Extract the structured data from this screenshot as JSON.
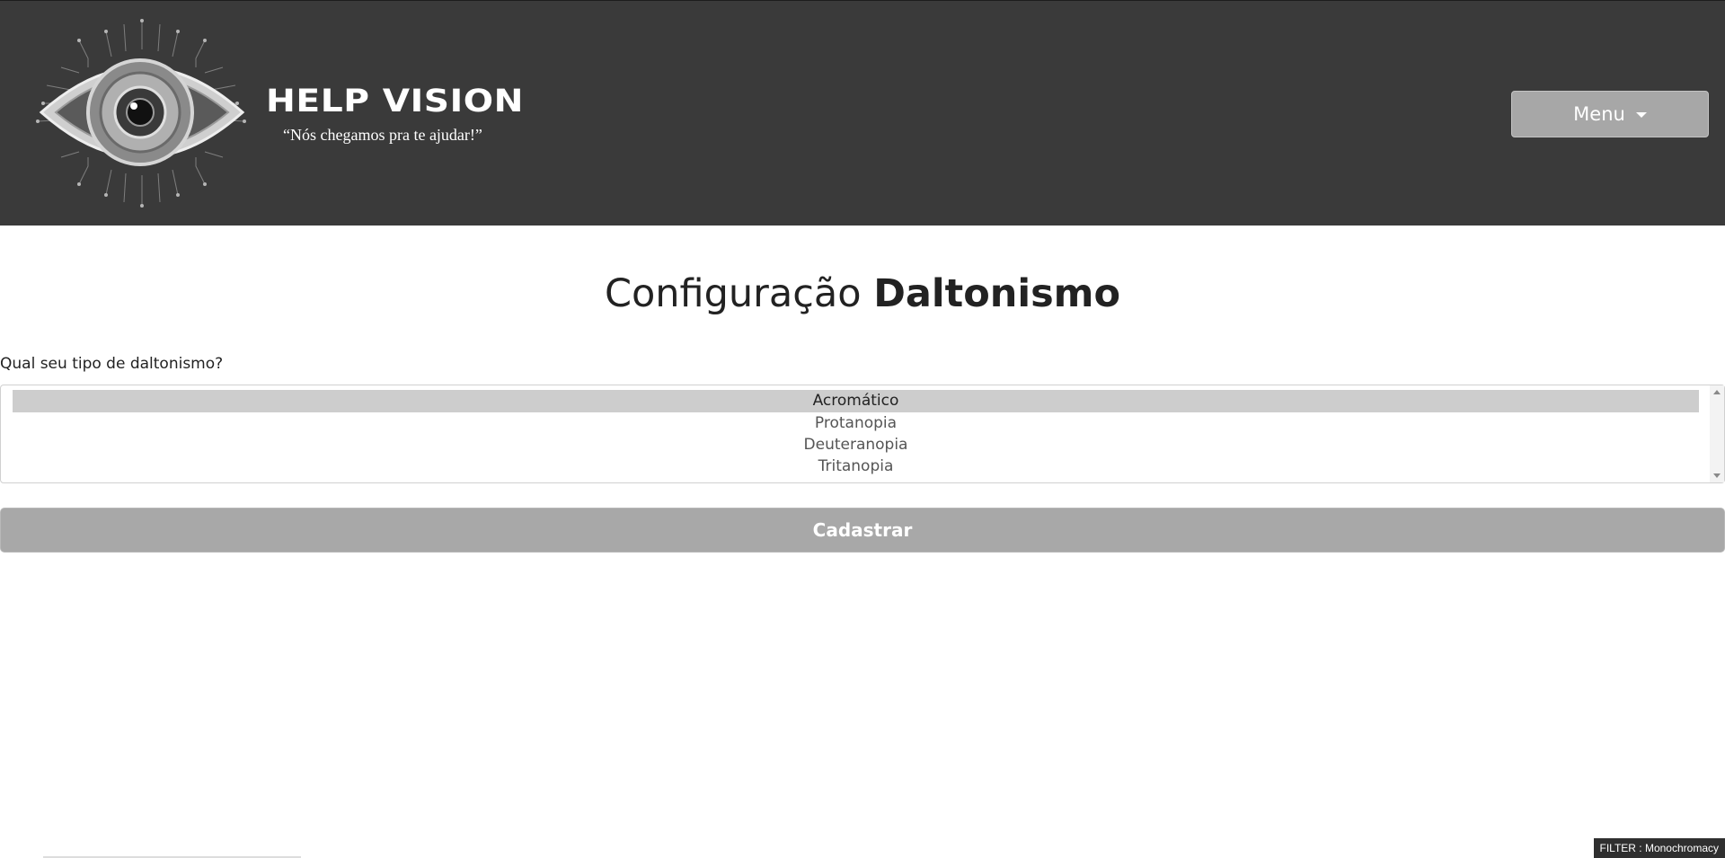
{
  "header": {
    "brand_title": "HELP VISION",
    "brand_tagline": "“Nós chegamos pra te ajudar!”",
    "menu_label": "Menu",
    "background": "#3a3a3a"
  },
  "main": {
    "title_regular": "Configuração",
    "title_bold": "Daltonismo",
    "question": "Qual seu tipo de daltonismo?",
    "options": [
      "Acromático",
      "Protanopia",
      "Deuteranopia",
      "Tritanopia"
    ],
    "selected_option": "Acromático",
    "submit_label": "Cadastrar",
    "submit_color": "#a8a8a8"
  },
  "filter_badge": "FILTER : Monochromacy",
  "icons": {
    "logo": "eye-logo-icon",
    "menu_caret": "caret-down-icon",
    "scroll_up": "chevron-up-icon",
    "scroll_down": "chevron-down-icon"
  }
}
